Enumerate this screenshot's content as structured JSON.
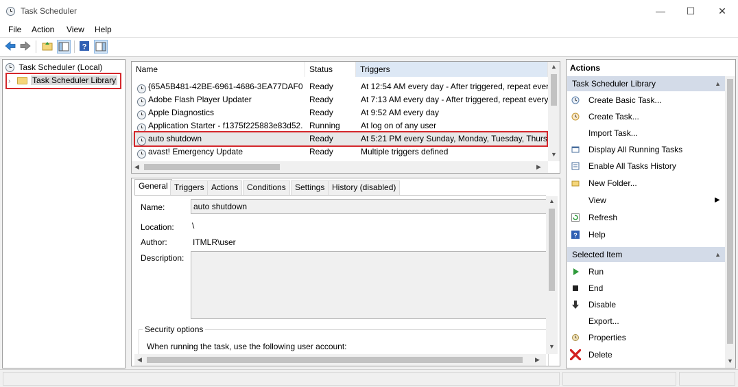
{
  "window": {
    "title": "Task Scheduler",
    "minimize_glyph": "—",
    "maximize_glyph": "☐",
    "close_glyph": "✕"
  },
  "menu": [
    "File",
    "Action",
    "View",
    "Help"
  ],
  "tree": {
    "root": "Task Scheduler (Local)",
    "library": "Task Scheduler Library"
  },
  "tasks": {
    "columns": [
      "Name",
      "Status",
      "Triggers"
    ],
    "rows": [
      {
        "name": "{65A5B481-42BE-6961-4686-3EA77DAF07...",
        "status": "Ready",
        "triggers": "At 12:54 AM every day - After triggered, repeat every"
      },
      {
        "name": "Adobe Flash Player Updater",
        "status": "Ready",
        "triggers": "At 7:13 AM every day - After triggered, repeat every"
      },
      {
        "name": "Apple Diagnostics",
        "status": "Ready",
        "triggers": "At 9:52 AM every day"
      },
      {
        "name": "Application Starter - f1375f225883e83d52...",
        "status": "Running",
        "triggers": "At log on of any user"
      },
      {
        "name": "auto shutdown",
        "status": "Ready",
        "triggers": "At 5:21 PM every Sunday, Monday, Tuesday, Thursd"
      },
      {
        "name": "avast! Emergency Update",
        "status": "Ready",
        "triggers": "Multiple triggers defined"
      }
    ],
    "selected_index": 4
  },
  "detail": {
    "tabs": [
      "General",
      "Triggers",
      "Actions",
      "Conditions",
      "Settings",
      "History (disabled)"
    ],
    "name_label": "Name:",
    "name_value": "auto shutdown",
    "location_label": "Location:",
    "location_value": "\\",
    "author_label": "Author:",
    "author_value": "ITMLR\\user",
    "description_label": "Description:",
    "security_title": "Security options",
    "security_text": "When running the task, use the following user account:"
  },
  "actions": {
    "header": "Actions",
    "library_section": "Task Scheduler Library",
    "library_items": [
      {
        "label": "Create Basic Task...",
        "icon": "create-basic-task-icon"
      },
      {
        "label": "Create Task...",
        "icon": "create-task-icon"
      },
      {
        "label": "Import Task...",
        "icon": ""
      },
      {
        "label": "Display All Running Tasks",
        "icon": "running-tasks-icon"
      },
      {
        "label": "Enable All Tasks History",
        "icon": "history-icon"
      },
      {
        "label": "New Folder...",
        "icon": "new-folder-icon"
      },
      {
        "label": "View",
        "icon": ""
      },
      {
        "label": "Refresh",
        "icon": "refresh-icon"
      },
      {
        "label": "Help",
        "icon": "help-icon"
      }
    ],
    "selected_section": "Selected Item",
    "selected_items": [
      {
        "label": "Run",
        "icon": "run-icon"
      },
      {
        "label": "End",
        "icon": "end-icon"
      },
      {
        "label": "Disable",
        "icon": "disable-icon"
      },
      {
        "label": "Export...",
        "icon": ""
      },
      {
        "label": "Properties",
        "icon": "properties-icon"
      },
      {
        "label": "Delete",
        "icon": "delete-icon"
      }
    ]
  },
  "colors": {
    "highlight_box": "#d4272b",
    "section_header": "#d3dbe8",
    "triggers_header": "#dde8f5"
  }
}
